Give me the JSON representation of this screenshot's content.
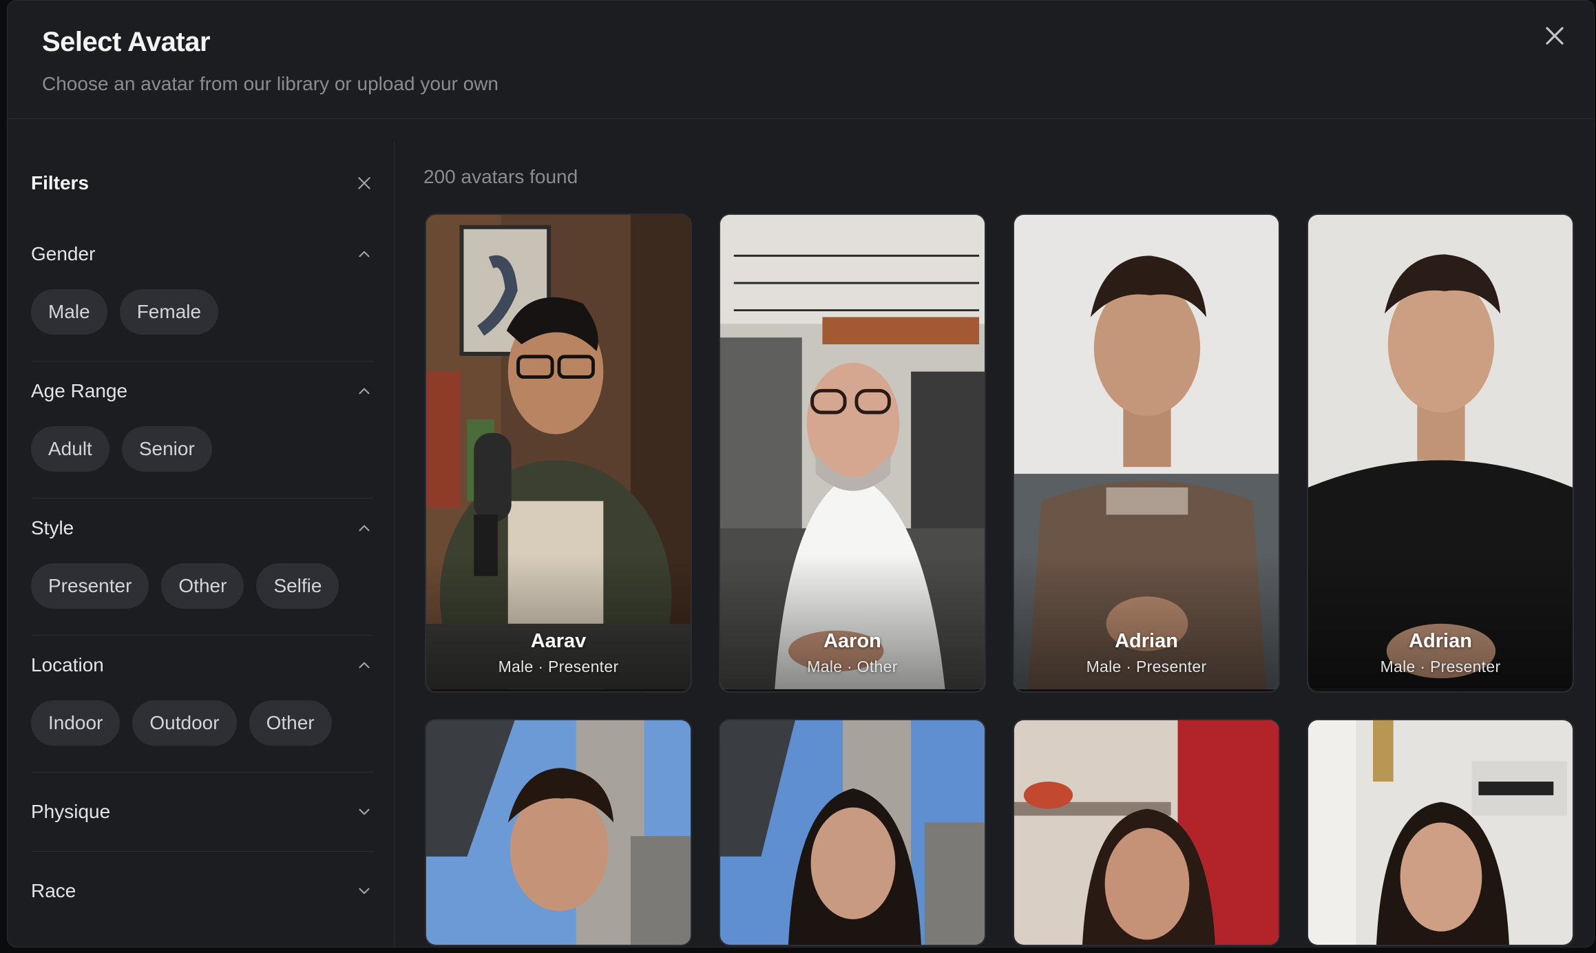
{
  "modal": {
    "title": "Select Avatar",
    "subtitle": "Choose an avatar from our library or upload your own",
    "close_icon": "close-icon"
  },
  "filters": {
    "title": "Filters",
    "sections": [
      {
        "title": "Gender",
        "expanded": true,
        "options": [
          "Male",
          "Female"
        ]
      },
      {
        "title": "Age Range",
        "expanded": true,
        "options": [
          "Adult",
          "Senior"
        ]
      },
      {
        "title": "Style",
        "expanded": true,
        "options": [
          "Presenter",
          "Other",
          "Selfie"
        ]
      },
      {
        "title": "Location",
        "expanded": true,
        "options": [
          "Indoor",
          "Outdoor",
          "Other"
        ]
      },
      {
        "title": "Physique",
        "expanded": false,
        "options": []
      },
      {
        "title": "Race",
        "expanded": false,
        "options": []
      }
    ]
  },
  "results": {
    "count_text": "200 avatars found",
    "avatars": [
      {
        "name": "Aarav",
        "meta": "Male · Presenter"
      },
      {
        "name": "Aaron",
        "meta": "Male · Other"
      },
      {
        "name": "Adrian",
        "meta": "Male · Presenter"
      },
      {
        "name": "Adrian",
        "meta": "Male · Presenter"
      }
    ]
  },
  "colors": {
    "background": "#1c1d21",
    "chip": "#2e2f34",
    "border": "#2c2d32",
    "text_primary": "#f4f4f5",
    "text_muted": "#8b8c92"
  }
}
